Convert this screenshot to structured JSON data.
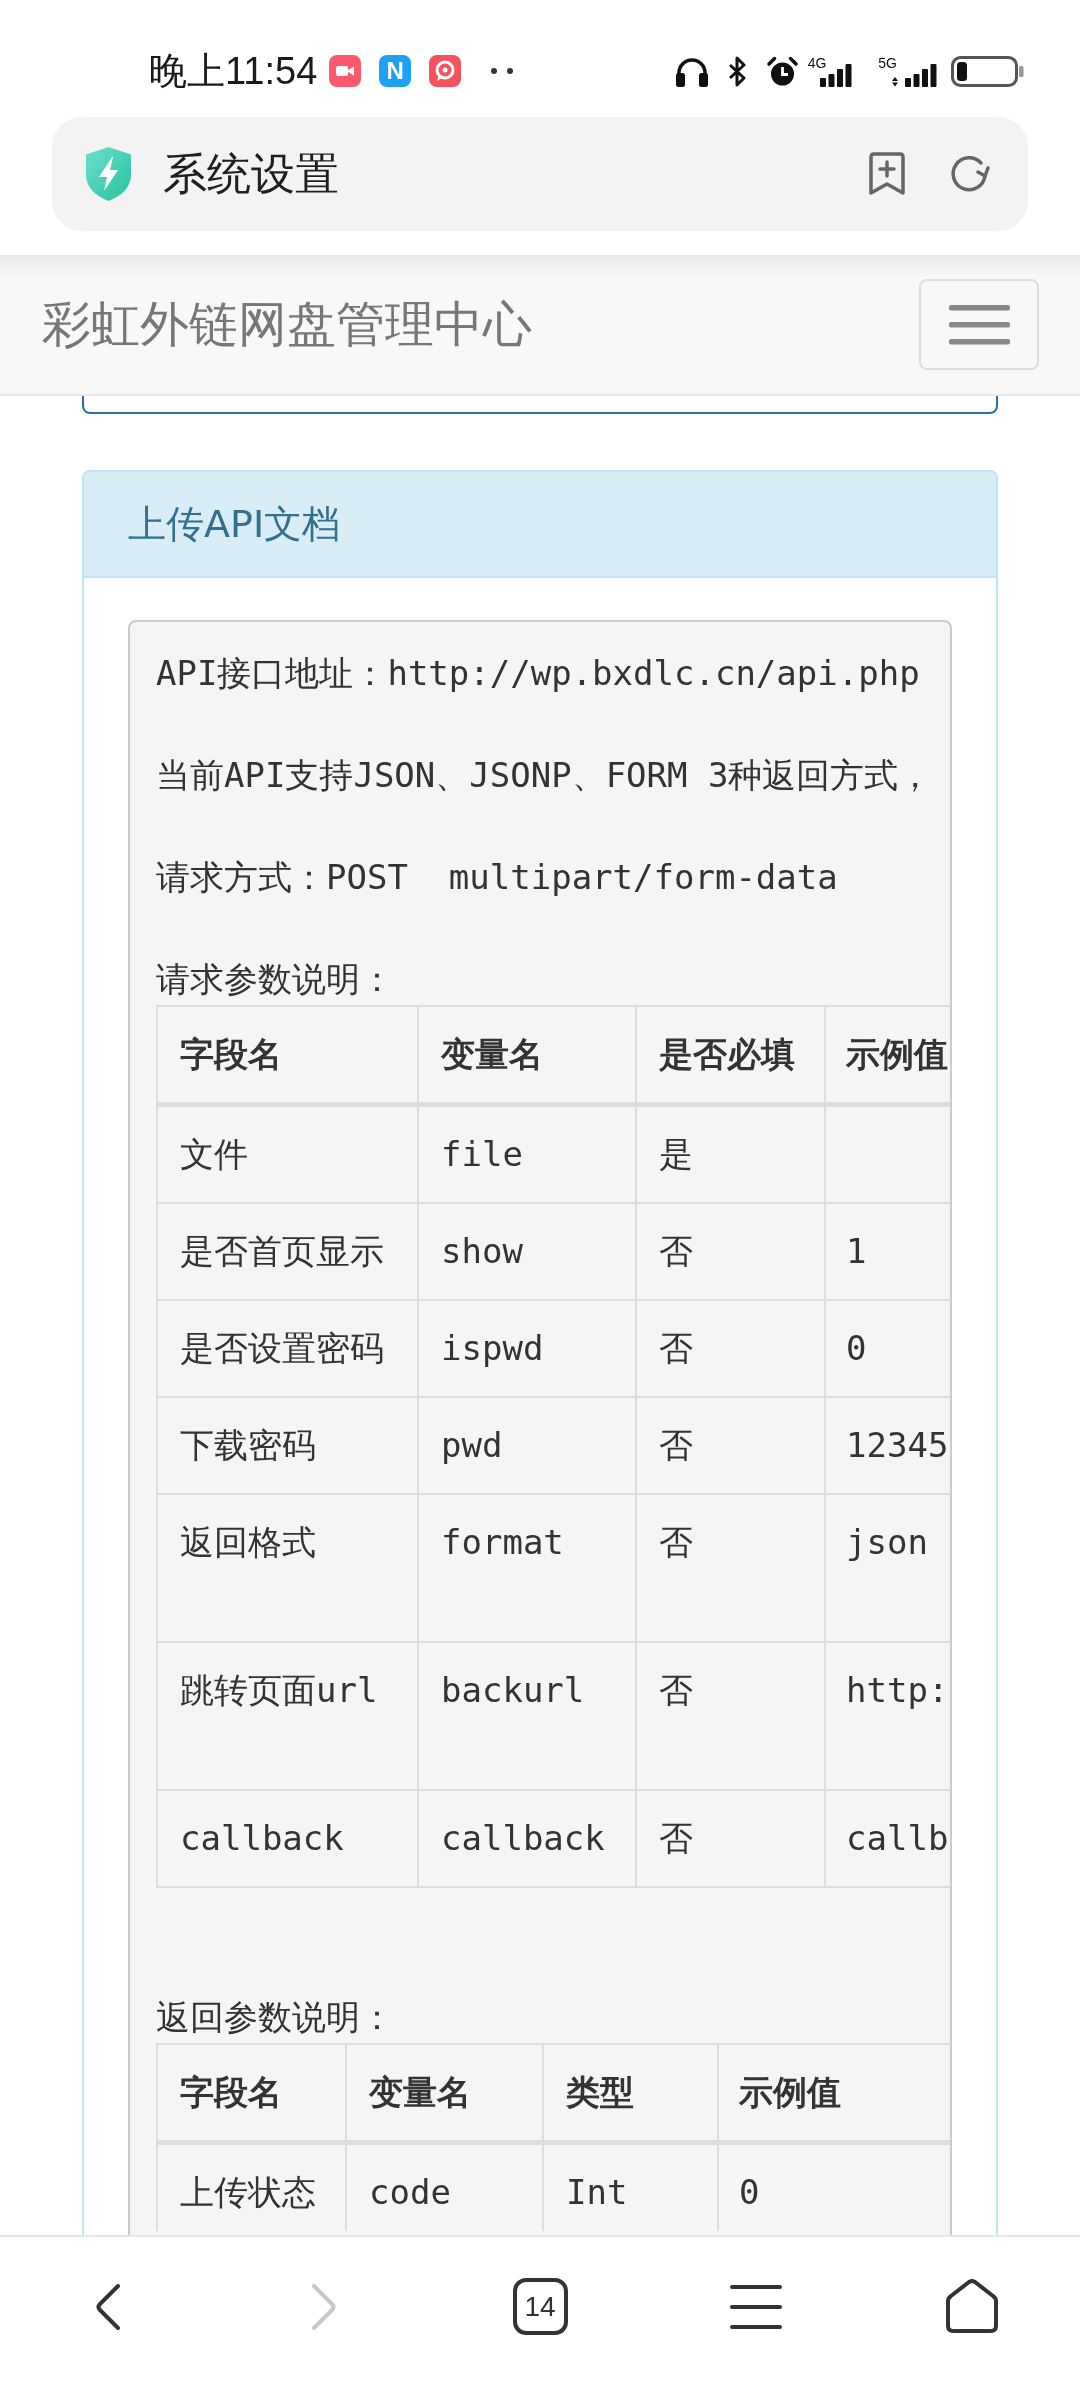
{
  "status_bar": {
    "time": "晚上11:54",
    "notification_icons": [
      {
        "kind": "video"
      },
      {
        "kind": "letter",
        "text": "N"
      },
      {
        "kind": "chat"
      }
    ],
    "networks": [
      {
        "label": "4G",
        "data_activity": false
      },
      {
        "label": "5G",
        "data_activity": true
      }
    ]
  },
  "browser_bar": {
    "title": "系统设置"
  },
  "navbar": {
    "brand": "彩虹外链网盘管理中心"
  },
  "panel": {
    "title": "上传API文档",
    "content": [
      {
        "kind": "line",
        "text": "API接口地址：http://wp.bxdlc.cn/api.php"
      },
      {
        "kind": "line",
        "text": "当前API支持JSON、JSONP、FORM 3种返回方式，"
      },
      {
        "kind": "line",
        "text": "请求方式：POST  multipart/form-data"
      },
      {
        "kind": "table",
        "caption": "请求参数说明：",
        "columns": [
          "字段名",
          "变量名",
          "是否必填",
          "示例值"
        ],
        "rows": [
          {
            "cells": [
              "文件",
              "file",
              "是"
            ]
          },
          {
            "cells": [
              "是否首页显示",
              "show",
              "否",
              "1"
            ]
          },
          {
            "cells": [
              "是否设置密码",
              "ispwd",
              "否",
              "0"
            ]
          },
          {
            "cells": [
              "下载密码",
              "pwd",
              "否",
              "12345"
            ]
          },
          {
            "cells": [
              "返回格式",
              "format",
              "否",
              "json"
            ]
          },
          {
            "cells": [
              "跳转页面url",
              "backurl",
              "否",
              "http:"
            ]
          },
          {
            "cells": [
              "callback",
              "callback",
              "否",
              "callb"
            ]
          }
        ]
      },
      {
        "kind": "table",
        "caption": "返回参数说明：",
        "columns": [
          "字段名",
          "变量名",
          "类型",
          "示例值"
        ],
        "rows": [
          {
            "cells": [
              "上传状态",
              "code",
              "Int",
              "0"
            ]
          }
        ]
      }
    ]
  },
  "bottom_nav": {
    "items": [
      {
        "kind": "back",
        "disabled": false
      },
      {
        "kind": "forward",
        "disabled": true
      },
      {
        "kind": "tabs",
        "text": "14"
      },
      {
        "kind": "menu"
      },
      {
        "kind": "home"
      }
    ]
  }
}
